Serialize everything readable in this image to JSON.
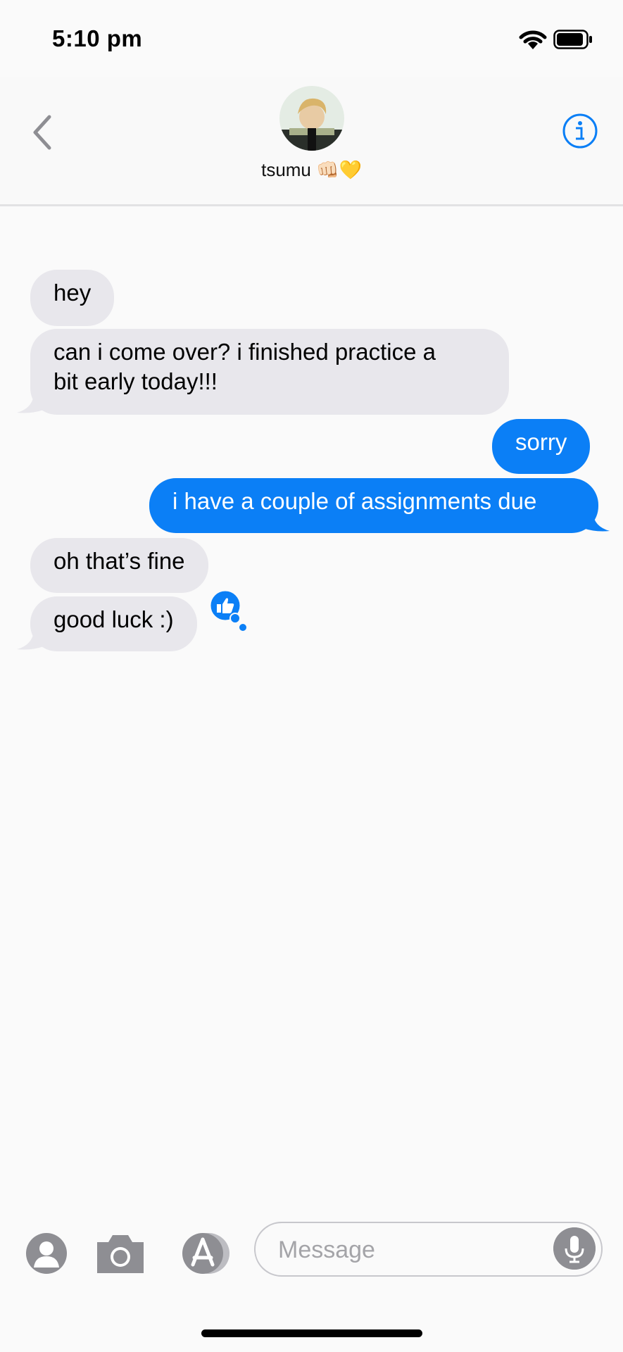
{
  "status": {
    "time": "5:10 pm"
  },
  "header": {
    "contact_name": "tsumu",
    "contact_emoji": "👊🏻💛"
  },
  "messages": [
    {
      "direction": "incoming",
      "text": "hey"
    },
    {
      "direction": "incoming",
      "text": "can i come over? i finished practice a\nbit early today!!!"
    },
    {
      "direction": "outgoing",
      "text": "sorry"
    },
    {
      "direction": "outgoing",
      "text": "i have a couple of assignments due"
    },
    {
      "direction": "incoming",
      "text": "oh that’s fine"
    },
    {
      "direction": "incoming",
      "text": "good luck :)",
      "reaction": "thumbs-up-icon"
    }
  ],
  "composer": {
    "placeholder": "Message"
  },
  "icons": {
    "back": "chevron-left-icon",
    "info": "info-icon",
    "contact_card": "contact-card-icon",
    "camera": "camera-icon",
    "app_store": "app-store-icon",
    "mic": "microphone-icon"
  },
  "colors": {
    "accent": "#0b7ff6",
    "incoming_bubble": "#e8e7ec",
    "icon_gray": "#8e8e93"
  }
}
